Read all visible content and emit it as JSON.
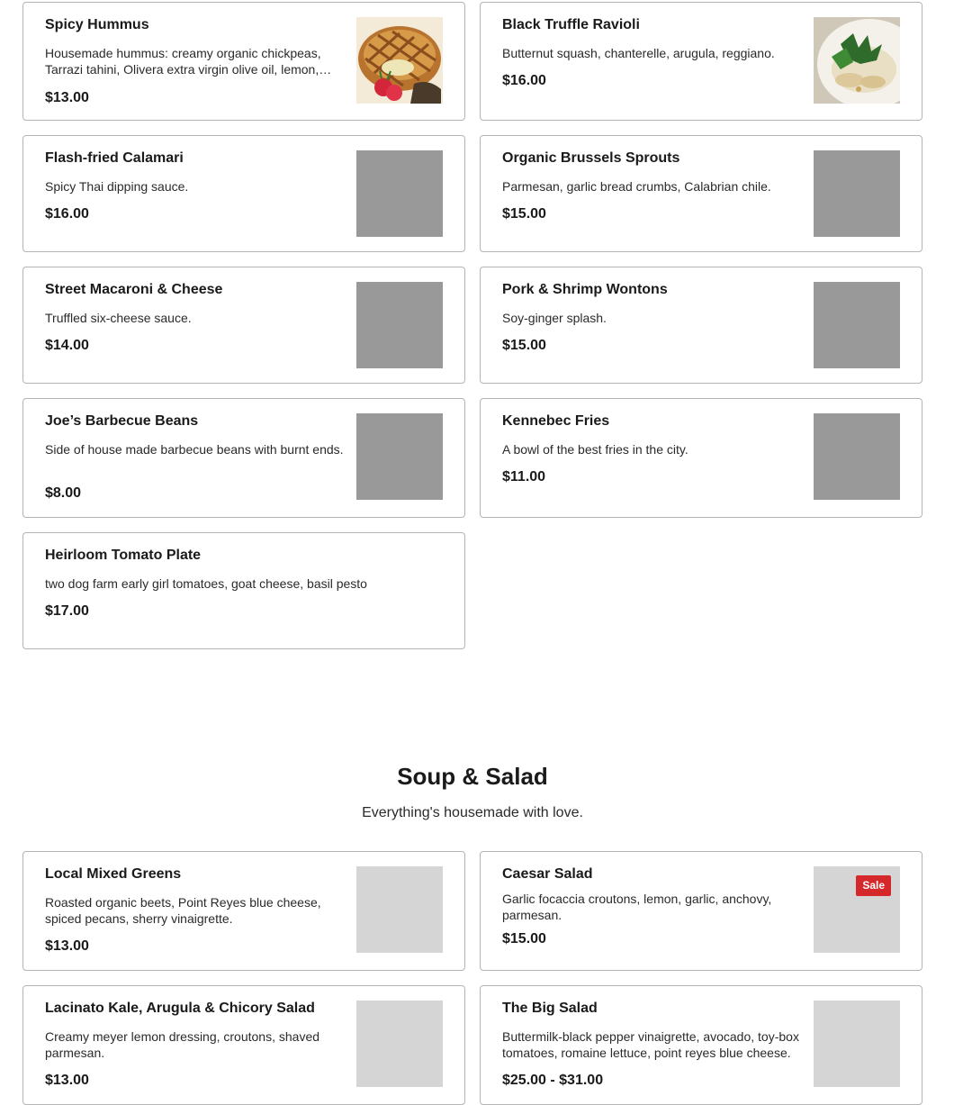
{
  "sections": [
    {
      "items": [
        {
          "name": "Spicy Hummus",
          "description": "Housemade hummus: creamy organic chickpeas, Tarrazi tahini, Olivera extra virgin olive oil, lemon, garlic.",
          "price": "$13.00",
          "image": "hummus-photo"
        },
        {
          "name": "Black Truffle Ravioli",
          "description": "Butternut squash, chanterelle, arugula, reggiano.",
          "price": "$16.00",
          "image": "ravioli-photo"
        },
        {
          "name": "Flash-fried Calamari",
          "description": "Spicy Thai dipping sauce.",
          "price": "$16.00",
          "image": "placeholder"
        },
        {
          "name": "Organic Brussels Sprouts",
          "description": "Parmesan, garlic bread crumbs, Calabrian chile.",
          "price": "$15.00",
          "image": "placeholder"
        },
        {
          "name": "Street Macaroni & Cheese",
          "description": "Truffled six-cheese sauce.",
          "price": "$14.00",
          "image": "placeholder"
        },
        {
          "name": "Pork & Shrimp Wontons",
          "description": "Soy-ginger splash.",
          "price": "$15.00",
          "image": "placeholder"
        },
        {
          "name": "Joe’s Barbecue Beans",
          "description": "Side of house made barbecue beans with burnt ends.",
          "price": "$8.00",
          "image": "placeholder"
        },
        {
          "name": "Kennebec Fries",
          "description": "A bowl of the best fries in the city.",
          "price": "$11.00",
          "image": "placeholder"
        },
        {
          "name": "Heirloom Tomato Plate",
          "description": "two dog farm early girl tomatoes, goat cheese, basil pesto",
          "price": "$17.00",
          "image": "none"
        }
      ]
    },
    {
      "title": "Soup & Salad",
      "subtitle": "Everything's housemade with love.",
      "items": [
        {
          "name": "Local Mixed Greens",
          "description": "Roasted organic beets, Point Reyes blue cheese, spiced pecans, sherry vinaigrette.",
          "price": "$13.00",
          "image": "placeholder-light"
        },
        {
          "name": "Caesar Salad",
          "description": "Garlic focaccia croutons, lemon, garlic, anchovy, parmesan.",
          "price": "$15.00",
          "image": "placeholder-light",
          "badge": "Sale"
        },
        {
          "name": "Lacinato Kale, Arugula & Chicory Salad",
          "description": "Creamy meyer lemon dressing, croutons, shaved parmesan.",
          "price": "$13.00",
          "image": "placeholder-light"
        },
        {
          "name": "The Big Salad",
          "description": "Buttermilk-black pepper vinaigrette, avocado, toy-box tomatoes, romaine lettuce, point reyes blue cheese.",
          "price": "$25.00 - $31.00",
          "image": "placeholder-light"
        }
      ]
    }
  ]
}
